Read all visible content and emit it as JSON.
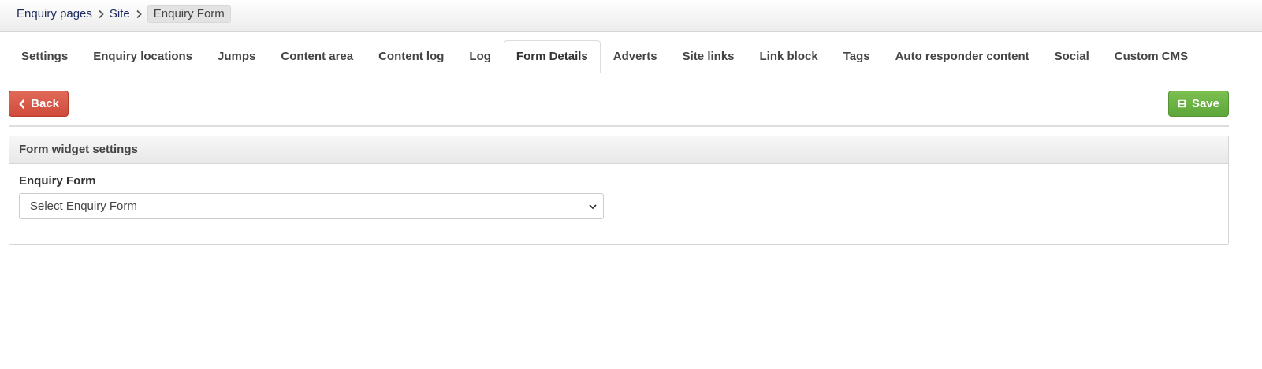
{
  "breadcrumb": {
    "items": [
      "Enquiry pages",
      "Site"
    ],
    "current": "Enquiry Form"
  },
  "tabs": [
    {
      "label": "Settings"
    },
    {
      "label": "Enquiry locations"
    },
    {
      "label": "Jumps"
    },
    {
      "label": "Content area"
    },
    {
      "label": "Content log"
    },
    {
      "label": "Log"
    },
    {
      "label": "Form Details",
      "active": true
    },
    {
      "label": "Adverts"
    },
    {
      "label": "Site links"
    },
    {
      "label": "Link block"
    },
    {
      "label": "Tags"
    },
    {
      "label": "Auto responder content"
    },
    {
      "label": "Social"
    },
    {
      "label": "Custom CMS"
    }
  ],
  "toolbar": {
    "back_label": "Back",
    "back_icon": "chevron-left-icon",
    "save_label": "Save",
    "save_icon": "floppy-disk-icon"
  },
  "panel": {
    "title": "Form widget settings",
    "field_label": "Enquiry Form",
    "select_value": "Select Enquiry Form",
    "select_icon": "chevron-down-icon"
  },
  "colors": {
    "back_button": "#d9584a",
    "save_button": "#6cb244",
    "link": "#1a2a5e"
  }
}
